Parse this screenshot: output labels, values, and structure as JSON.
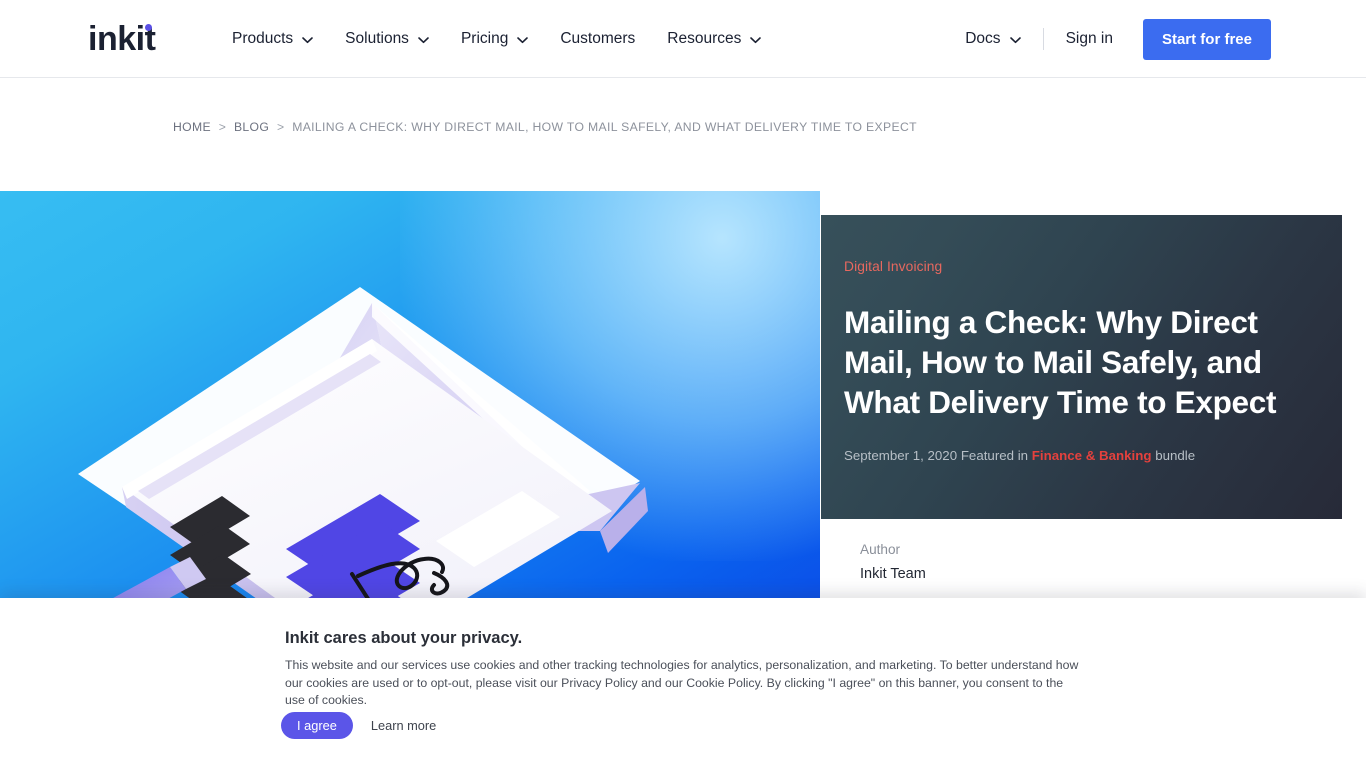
{
  "header": {
    "logo_text": "inkit",
    "nav_items": [
      {
        "label": "Products",
        "has_caret": true,
        "icon": "chevron-down-icon"
      },
      {
        "label": "Solutions",
        "has_caret": true,
        "icon": "chevron-down-icon"
      },
      {
        "label": "Pricing",
        "has_caret": true,
        "icon": "chevron-down-icon"
      },
      {
        "label": "Customers",
        "has_caret": false,
        "icon": ""
      },
      {
        "label": "Resources",
        "has_caret": true,
        "icon": "chevron-down-icon"
      }
    ],
    "docs_label": "Docs",
    "signin_label": "Sign in",
    "cta_label": "Start for free",
    "cta_color": "#3b6cf0",
    "logo_dot_color": "#5b50e6"
  },
  "breadcrumb": {
    "home": "HOME",
    "blog": "BLOG",
    "separator": ">",
    "current": "MAILING A CHECK: WHY DIRECT MAIL, HOW TO MAIL SAFELY, AND WHAT DELIVERY TIME TO EXPECT"
  },
  "hero": {
    "illustration_name": "isometric-check-envelope-illustration",
    "gradient_from": "#37bdf2",
    "gradient_to": "#0b50e8"
  },
  "article": {
    "category": "Digital Invoicing",
    "category_color": "#e7685f",
    "title": "Mailing a Check: Why Direct Mail, How to Mail Safely, and What Delivery Time to Expect",
    "date": "September 1, 2020",
    "featured_prefix": "Featured in",
    "bundle_name": "Finance & Banking",
    "bundle_color": "#e5413d",
    "bundle_suffix": "bundle",
    "card_gradient_from": "#37505a",
    "card_gradient_to": "#272a38"
  },
  "author": {
    "label": "Author",
    "name": "Inkit Team"
  },
  "cookie_banner": {
    "title": "Inkit cares about your privacy.",
    "body": "This website and our services use cookies and other tracking technologies for analytics, personalization, and marketing. To better understand how our cookies are used or to opt-out, please visit our Privacy Policy and our Cookie Policy. By clicking \"I agree\" on this banner, you consent to the use of cookies.",
    "agree_label": "I agree",
    "learn_more_label": "Learn more",
    "agree_color": "#5b55e8"
  }
}
